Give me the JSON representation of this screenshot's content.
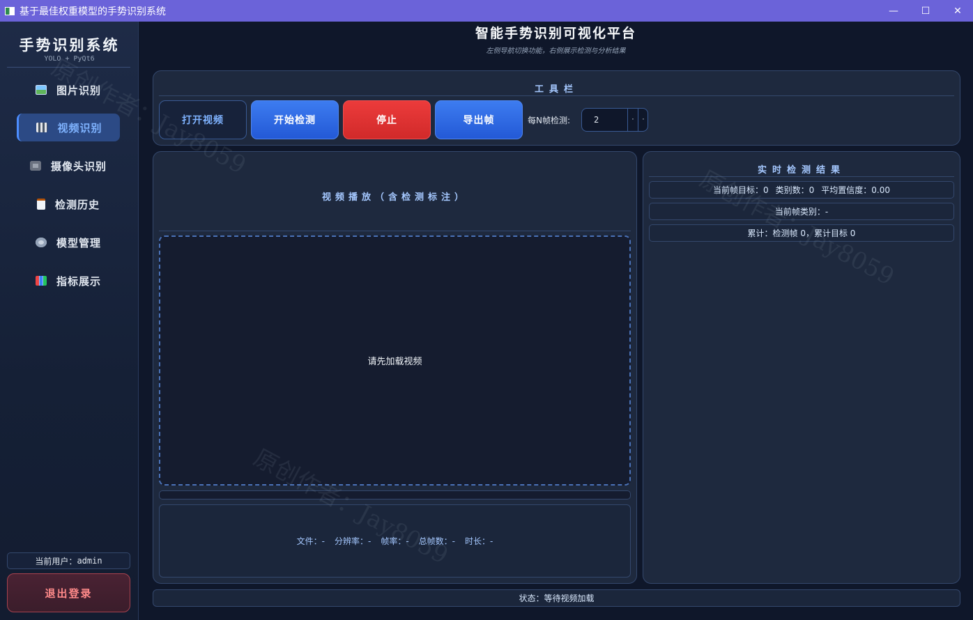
{
  "window": {
    "title": "基于最佳权重模型的手势识别系统",
    "minimize": "—",
    "maximize": "☐",
    "close": "✕"
  },
  "sidebar": {
    "title": "手势识别系统",
    "subtitle": "YOLO + PyQt6",
    "items": [
      {
        "label": "图片识别",
        "icon": "image-icon",
        "active": false
      },
      {
        "label": "视频识别",
        "icon": "clapperboard-icon",
        "active": true
      },
      {
        "label": "摄像头识别",
        "icon": "camera-icon",
        "active": false
      },
      {
        "label": "检测历史",
        "icon": "clipboard-icon",
        "active": false
      },
      {
        "label": "模型管理",
        "icon": "gear-icon",
        "active": false
      },
      {
        "label": "指标展示",
        "icon": "bar-chart-icon",
        "active": false
      }
    ],
    "user_label": "当前用户：",
    "user_name": "admin",
    "logout_label": "退出登录"
  },
  "header": {
    "title": "智能手势识别可视化平台",
    "subtitle": "左侧导航切换功能，右侧展示检测与分析结果"
  },
  "toolbar": {
    "title": "工具栏",
    "open_video": "打开视频",
    "start_detect": "开始检测",
    "stop": "停止",
    "export_frame": "导出帧",
    "every_n_label": "每N帧检测:",
    "every_n_value": "2"
  },
  "video_panel": {
    "title": "视频播放（含检测标注）",
    "placeholder": "请先加载视频",
    "progress": 0,
    "info": {
      "file": "文件：-",
      "resolution": "分辨率：-",
      "fps": "帧率：-",
      "total_frames": "总帧数：-",
      "duration": "时长：-"
    }
  },
  "results_panel": {
    "title": "实时检测结果",
    "row1": {
      "targets": "当前帧目标：0",
      "classes": "类别数：0",
      "avg_conf": "平均置信度：0.00"
    },
    "row2": "当前帧类别：-",
    "row3": "累计：检测帧 0，累计目标 0"
  },
  "status": "状态：等待视频加载",
  "watermark": "原创作者：Jay8059",
  "colors": {
    "titlebar": "#6b63d9",
    "accent_blue": "#3d7cf0",
    "danger_red": "#e03434",
    "panel_bg": "#1e293e",
    "page_bg": "#0f172a"
  }
}
